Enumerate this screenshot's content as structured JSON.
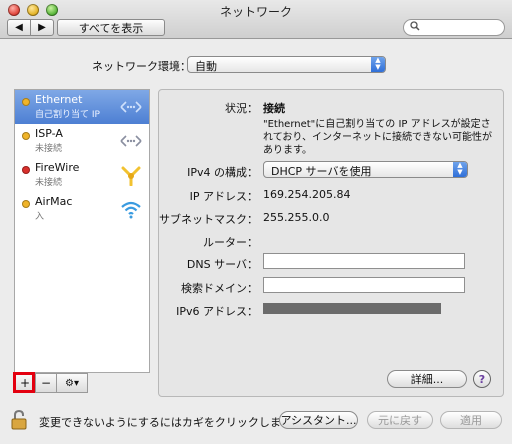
{
  "window": {
    "title": "ネットワーク",
    "show_all": "すべてを表示",
    "back_glyph": "◀",
    "forward_glyph": "▶"
  },
  "location": {
    "label": "ネットワーク環境：",
    "value": "自動"
  },
  "services": [
    {
      "name": "Ethernet",
      "status": "自己割り当て IP",
      "dot": "#f0b429",
      "icon": "ethernet-icon",
      "selected": true
    },
    {
      "name": "ISP-A",
      "status": "未接続",
      "dot": "#f0b429",
      "icon": "ppp-icon",
      "selected": false
    },
    {
      "name": "FireWire",
      "status": "未接続",
      "dot": "#d9302c",
      "icon": "firewire-icon",
      "selected": false
    },
    {
      "name": "AirMac",
      "status": "入",
      "dot": "#f0b429",
      "icon": "wifi-icon",
      "selected": false
    }
  ],
  "sidebar_buttons": {
    "add": "+",
    "remove": "−",
    "action": "⚙▾"
  },
  "detail": {
    "status_label": "状況：",
    "status_value": "接続",
    "status_message": "\"Ethernet\"に自己割り当ての IP アドレスが設定されており、インターネットに接続できない可能性があります。",
    "ipv4_label": "IPv4 の構成：",
    "ipv4_value": "DHCP サーバを使用",
    "ip_label": "IP アドレス：",
    "ip_value": "169.254.205.84",
    "subnet_label": "サブネットマスク：",
    "subnet_value": "255.255.0.0",
    "router_label": "ルーター：",
    "dns_label": "DNS サーバ：",
    "search_domain_label": "検索ドメイン：",
    "ipv6_label": "IPv6 アドレス：",
    "advanced_button": "詳細...",
    "help_button": "?"
  },
  "footer": {
    "lock_text": "変更できないようにするにはカギをクリックします。",
    "assistant": "アシスタント...",
    "revert": "元に戻す",
    "apply": "適用"
  },
  "colors": {
    "selection": "#5a86d6",
    "highlight": "#e3000f",
    "popup_accent": "#2f6fd8"
  }
}
